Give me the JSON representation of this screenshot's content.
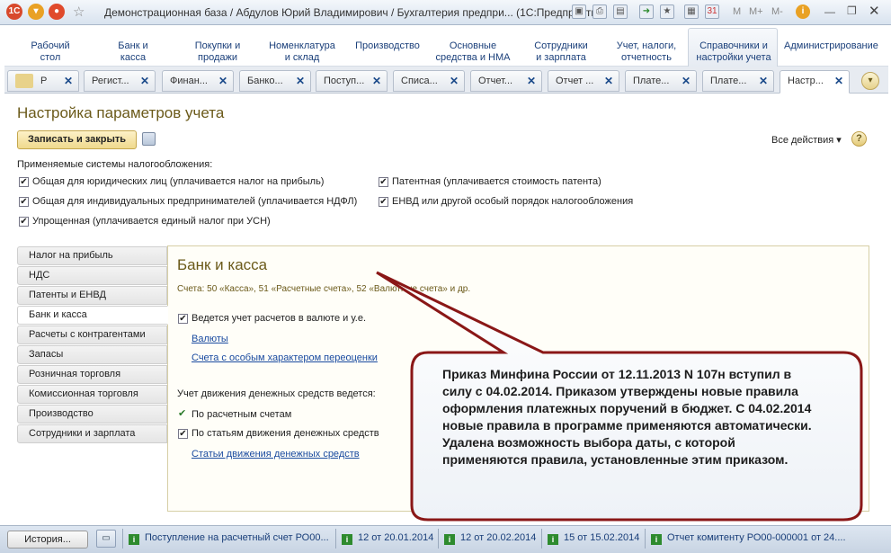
{
  "window": {
    "title": "Демонстрационная база / Абдулов Юрий Владимирович / Бухгалтерия предпри...  (1С:Предприятие)",
    "mem_buttons": [
      "M",
      "M+",
      "M-"
    ]
  },
  "sections": [
    {
      "label": "Рабочий\nстол"
    },
    {
      "label": "Банк и\nкасса"
    },
    {
      "label": "Покупки и\nпродажи"
    },
    {
      "label": "Номенклатура\nи склад"
    },
    {
      "label": "Производство"
    },
    {
      "label": "Основные\nсредства и НМА"
    },
    {
      "label": "Сотрудники\nи зарплата"
    },
    {
      "label": "Учет, налоги,\nотчетность"
    },
    {
      "label": "Справочники и\nнастройки учета"
    },
    {
      "label": "Администрирование"
    }
  ],
  "open_tabs": [
    "Р",
    "Регист...",
    "Финан...",
    "Банко...",
    "Поступ...",
    "Списа...",
    "Отчет...",
    "Отчет ...",
    "Плате...",
    "Плате...",
    "Настр..."
  ],
  "form": {
    "title": "Настройка параметров учета",
    "save_close_label": "Записать и закрыть",
    "all_actions_label": "Все действия ▾",
    "help_label": "?",
    "tax_systems_caption": "Применяемые системы налогообложения:",
    "tax_options": [
      {
        "label": "Общая для юридических лиц (уплачивается налог на прибыль)",
        "checked": true
      },
      {
        "label": "Патентная (уплачивается стоимость патента)",
        "checked": true
      },
      {
        "label": "Общая для индивидуальных предпринимателей (уплачивается НДФЛ)",
        "checked": true
      },
      {
        "label": "ЕНВД или другой особый порядок налогообложения",
        "checked": true
      },
      {
        "label": "Упрощенная (уплачивается единый налог при УСН)",
        "checked": true
      }
    ]
  },
  "nav": [
    {
      "label": "Налог на прибыль"
    },
    {
      "label": "НДС"
    },
    {
      "label": "Патенты и ЕНВД"
    },
    {
      "label": "Банк и касса",
      "active": true
    },
    {
      "label": "Расчеты с контрагентами"
    },
    {
      "label": "Запасы"
    },
    {
      "label": "Розничная торговля"
    },
    {
      "label": "Комиссионная торговля"
    },
    {
      "label": "Производство"
    },
    {
      "label": "Сотрудники и зарплата"
    }
  ],
  "panel": {
    "title": "Банк и касса",
    "subtitle": "Счета: 50 «Касса», 51 «Расчетные счета», 52 «Валютные счета» и др.",
    "currency_check_label": "Ведется учет расчетов в валюте и у.е.",
    "currencies_link": "Валюты",
    "special_accounts_link": "Счета с особым характером переоценки",
    "cash_flow_caption": "Учет движения денежных средств ведется:",
    "by_accounts_label": "По расчетным счетам",
    "by_items_label": "По статьям движения денежных средств",
    "cash_flow_items_link": "Статьи движения денежных средств"
  },
  "callout": {
    "text": "Приказ Минфина России от 12.11.2013 N 107н вступил в силу с 04.02.2014. Приказом утверждены новые правила оформления платежных поручений в бюджет. С 04.02.2014 новые правила в программе применяются автоматически. Удалена возможность выбора даты, с которой применяются правила, установленные этим приказом."
  },
  "statusbar": {
    "history_label": "История...",
    "tasks": [
      "Поступление на расчетный счет РО00...",
      "12 от 20.01.2014",
      "12 от 20.02.2014",
      "15 от 15.02.2014",
      "Отчет комитенту РО00-000001 от 24...."
    ]
  },
  "colors": {
    "accent_title": "#6b5a1a",
    "link": "#1a4ba0",
    "save_button": "#efd98d"
  }
}
